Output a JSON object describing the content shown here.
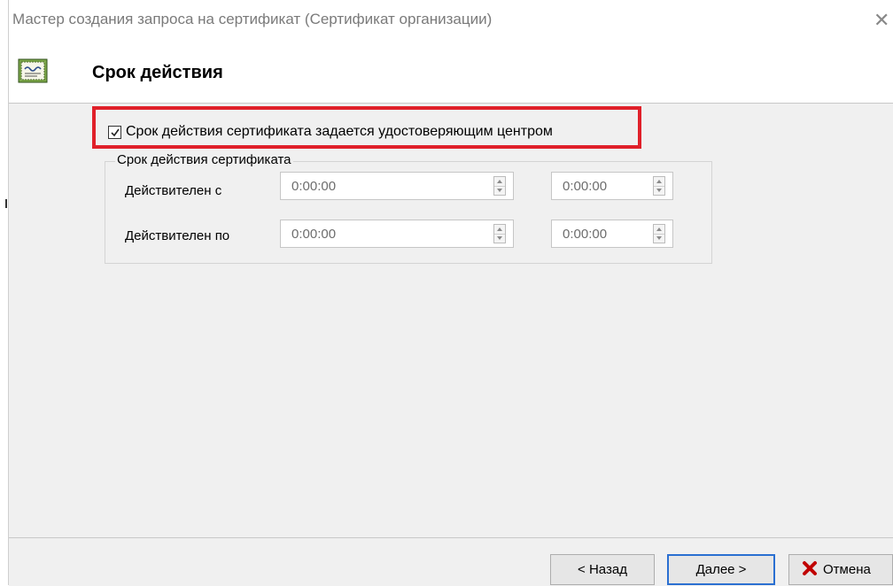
{
  "window": {
    "title": "Мастер создания запроса на сертификат (Сертификат организации)",
    "close_glyph": "✕"
  },
  "header": {
    "title": "Срок действия",
    "icon": "certificate-icon"
  },
  "checkbox": {
    "label": "Срок действия сертификата задается удостоверяющим центром",
    "checked": true
  },
  "validity": {
    "group_label": "Срок действия сертификата",
    "rows": [
      {
        "label": "Действителен с",
        "time1": "0:00:00",
        "time2": "0:00:00"
      },
      {
        "label": "Действителен по",
        "time1": "0:00:00",
        "time2": "0:00:00"
      }
    ]
  },
  "buttons": {
    "back": "< Назад",
    "next": "Далее >",
    "cancel": "Отмена"
  },
  "colors": {
    "highlight": "#e0202a",
    "default_button_border": "#2a6fd1",
    "cancel_icon": "#c00000"
  }
}
